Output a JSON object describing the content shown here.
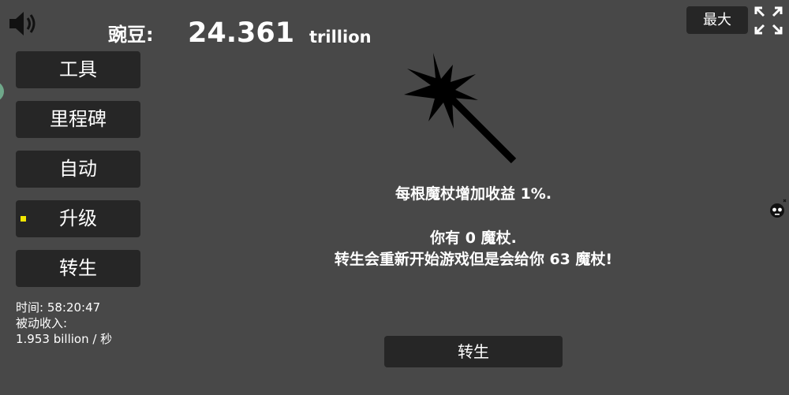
{
  "header": {
    "currency_label": "豌豆:",
    "currency_value": "24.361",
    "currency_unit": "trillion",
    "max_label": "最大"
  },
  "menu": {
    "items": [
      {
        "label": "工具"
      },
      {
        "label": "里程碑"
      },
      {
        "label": "自动"
      },
      {
        "label": "升级"
      },
      {
        "label": "转生"
      }
    ]
  },
  "stats": {
    "time_label": "时间: 58:20:47",
    "passive_label": "被动收入:",
    "passive_value": "1.953 billion / 秒"
  },
  "prestige": {
    "wand_bonus": "每根魔杖增加收益 1%.",
    "wand_count": "你有 0 魔杖.",
    "wand_reward": "转生会重新开始游戏但是会给你 63 魔杖!",
    "button_label": "转生"
  },
  "icons": {
    "speaker": "speaker-icon",
    "fullscreen": "fullscreen-icon",
    "wand": "magic-wand-icon",
    "bot": "bot-icon"
  }
}
